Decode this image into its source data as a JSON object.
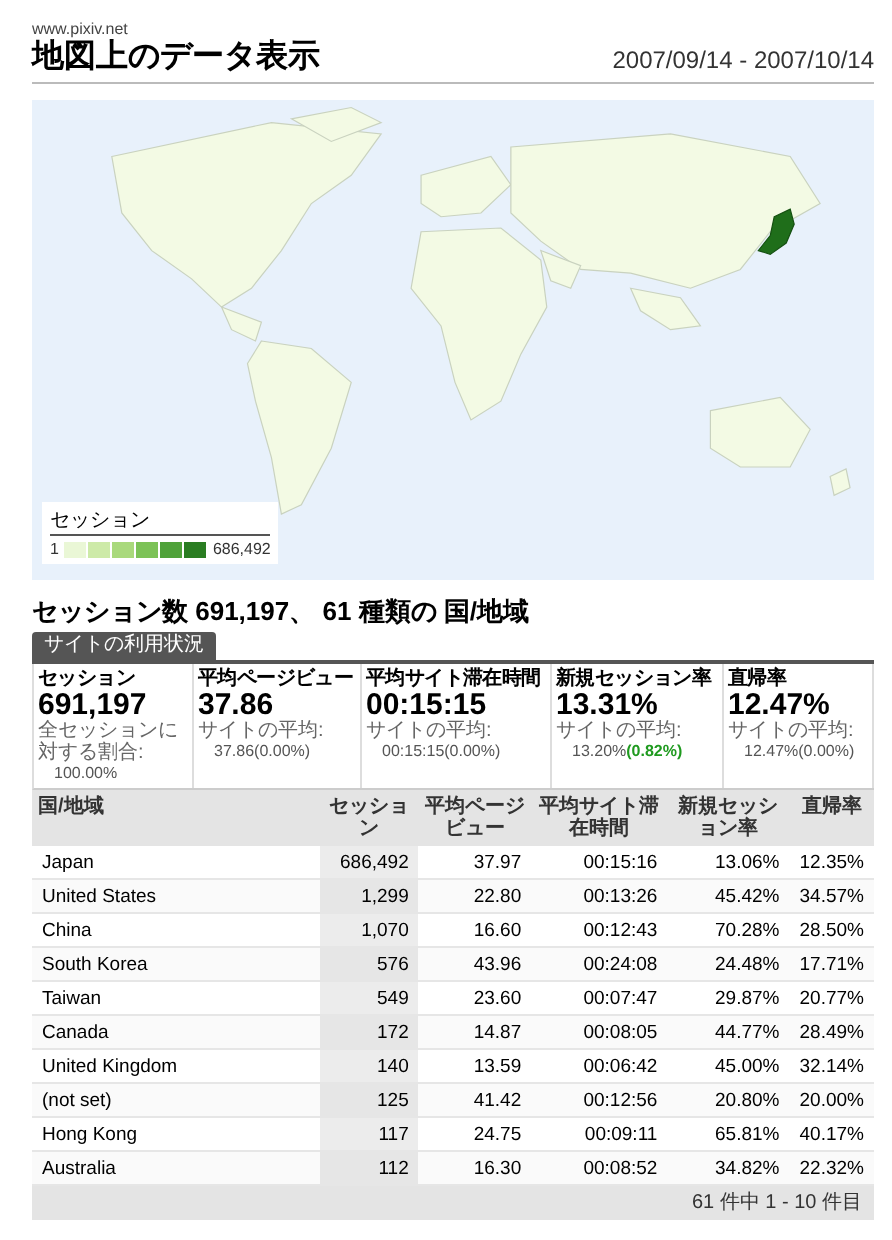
{
  "header": {
    "site": "www.pixiv.net",
    "title": "地図上のデータ表示",
    "date_range": "2007/09/14 - 2007/10/14"
  },
  "map": {
    "legend": {
      "title": "セッション",
      "min": "1",
      "max": "686,492"
    }
  },
  "summary_title": "セッション数 691,197、 61 種類の 国/地域",
  "tab": {
    "label": "サイトの利用状況",
    "selected": true
  },
  "metrics": [
    {
      "label": "セッション",
      "value": "691,197",
      "sub_label": "全セッションに対する割合:",
      "sub_value": "100.00%"
    },
    {
      "label": "平均ページビュー",
      "value": "37.86",
      "sub_label": "サイトの平均:",
      "sub_value": "37.86",
      "change": "(0.00%)",
      "change_positive": false
    },
    {
      "label": "平均サイト滞在時間",
      "value": "00:15:15",
      "sub_label": "サイトの平均:",
      "sub_value": "00:15:15",
      "change": "(0.00%)",
      "change_positive": false
    },
    {
      "label": "新規セッション率",
      "value": "13.31%",
      "sub_label": "サイトの平均:",
      "sub_value": "13.20%",
      "change": "(0.82%)",
      "change_positive": true
    },
    {
      "label": "直帰率",
      "value": "12.47%",
      "sub_label": "サイトの平均:",
      "sub_value": "12.47%",
      "change": "(0.00%)",
      "change_positive": false
    }
  ],
  "table": {
    "columns": [
      "国/地域",
      "セッション",
      "平均ページビュー",
      "平均サイト滞在時間",
      "新規セッション率",
      "直帰率"
    ],
    "rows": [
      [
        "Japan",
        "686,492",
        "37.97",
        "00:15:16",
        "13.06%",
        "12.35%"
      ],
      [
        "United States",
        "1,299",
        "22.80",
        "00:13:26",
        "45.42%",
        "34.57%"
      ],
      [
        "China",
        "1,070",
        "16.60",
        "00:12:43",
        "70.28%",
        "28.50%"
      ],
      [
        "South Korea",
        "576",
        "43.96",
        "00:24:08",
        "24.48%",
        "17.71%"
      ],
      [
        "Taiwan",
        "549",
        "23.60",
        "00:07:47",
        "29.87%",
        "20.77%"
      ],
      [
        "Canada",
        "172",
        "14.87",
        "00:08:05",
        "44.77%",
        "28.49%"
      ],
      [
        "United Kingdom",
        "140",
        "13.59",
        "00:06:42",
        "45.00%",
        "32.14%"
      ],
      [
        "(not set)",
        "125",
        "41.42",
        "00:12:56",
        "20.80%",
        "20.00%"
      ],
      [
        "Hong Kong",
        "117",
        "24.75",
        "00:09:11",
        "65.81%",
        "40.17%"
      ],
      [
        "Australia",
        "112",
        "16.30",
        "00:08:52",
        "34.82%",
        "22.32%"
      ]
    ],
    "pagination": "61 件中 1 - 10 件目"
  }
}
